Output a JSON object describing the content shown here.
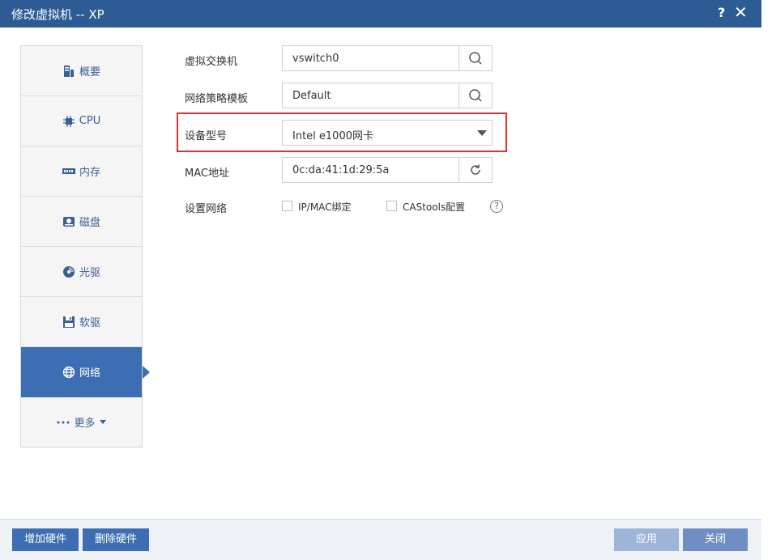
{
  "window": {
    "title": "修改虚拟机 -- XP",
    "help": "?",
    "close": "✕"
  },
  "sidebar": {
    "items": [
      {
        "label": "概要",
        "icon": "summary-icon"
      },
      {
        "label": "CPU",
        "icon": "cpu-icon"
      },
      {
        "label": "内存",
        "icon": "memory-icon"
      },
      {
        "label": "磁盘",
        "icon": "disk-icon"
      },
      {
        "label": "光驱",
        "icon": "cdrom-icon"
      },
      {
        "label": "软驱",
        "icon": "floppy-icon"
      },
      {
        "label": "网络",
        "icon": "globe-icon",
        "active": true
      },
      {
        "label": "更多",
        "icon": "more-dots-icon"
      }
    ]
  },
  "form": {
    "vswitch": {
      "label": "虚拟交换机",
      "value": "vswitch0"
    },
    "policy": {
      "label": "网络策略模板",
      "value": "Default"
    },
    "device": {
      "label": "设备型号",
      "value": "Intel e1000网卡"
    },
    "mac": {
      "label": "MAC地址",
      "value": "0c:da:41:1d:29:5a"
    },
    "network": {
      "label": "设置网络",
      "ipmac": "IP/MAC绑定",
      "castools": "CAStools配置",
      "help": "?"
    }
  },
  "footer": {
    "add": "增加硬件",
    "remove": "删除硬件",
    "apply": "应用",
    "close": "关闭"
  },
  "colors": {
    "title_bar": "#2d5b93",
    "accent": "#3d6db2",
    "highlight": "#e03232"
  }
}
